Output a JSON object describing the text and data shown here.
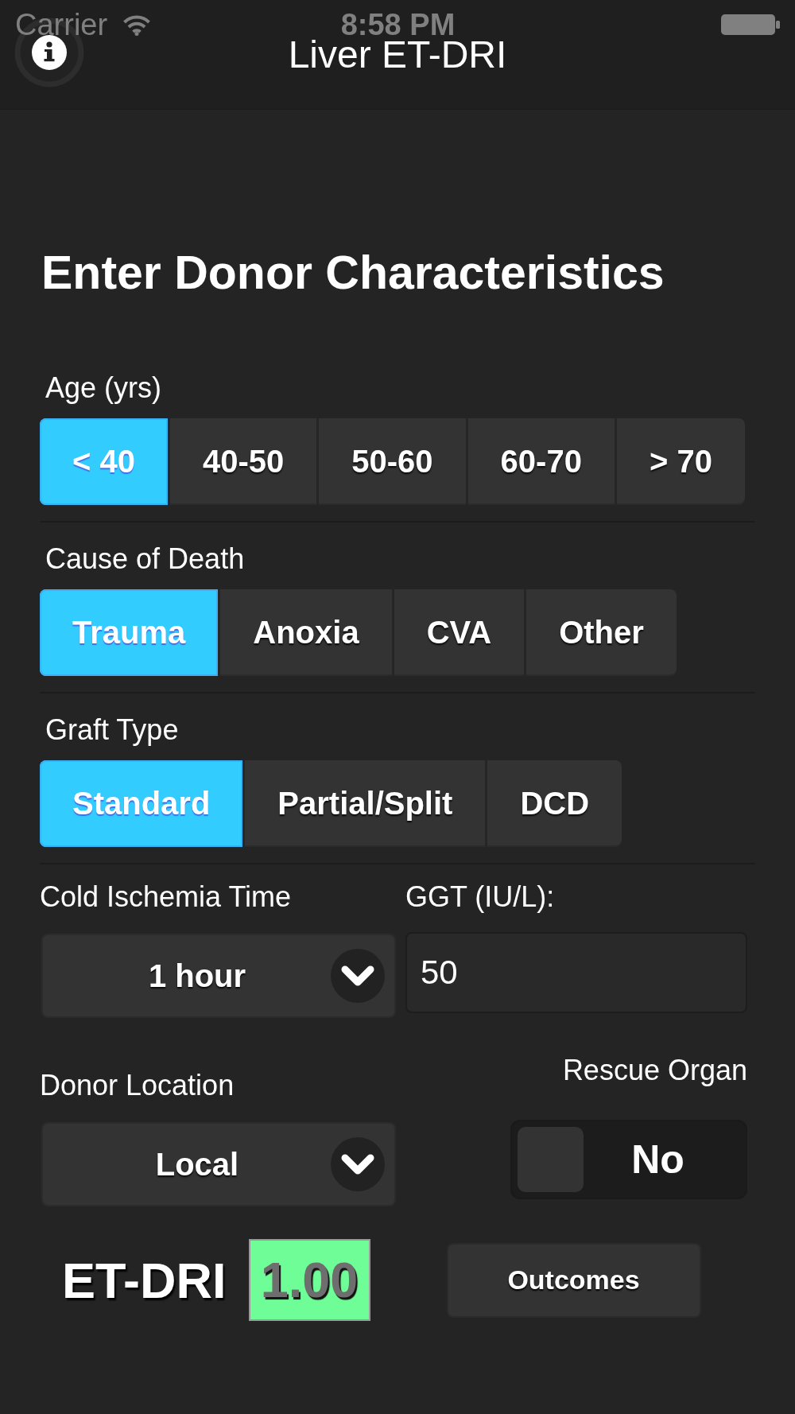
{
  "status_bar": {
    "carrier": "Carrier",
    "time": "8:58 PM"
  },
  "nav_bar": {
    "title": "Liver ET-DRI"
  },
  "heading": "Enter Donor Characteristics",
  "segments": [
    {
      "label": "Age (yrs)",
      "options": [
        {
          "label": "< 40",
          "selected": true
        },
        {
          "label": "40-50",
          "selected": false
        },
        {
          "label": "50-60",
          "selected": false
        },
        {
          "label": "60-70",
          "selected": false
        },
        {
          "label": "> 70",
          "selected": false
        }
      ]
    },
    {
      "label": "Cause of Death",
      "options": [
        {
          "label": "Trauma",
          "selected": true
        },
        {
          "label": "Anoxia",
          "selected": false
        },
        {
          "label": "CVA",
          "selected": false
        },
        {
          "label": "Other",
          "selected": false
        }
      ]
    },
    {
      "label": "Graft Type",
      "options": [
        {
          "label": "Standard",
          "selected": true
        },
        {
          "label": "Partial/Split",
          "selected": false
        },
        {
          "label": "DCD",
          "selected": false
        }
      ]
    }
  ],
  "cold_ischemia_time": {
    "label": "Cold Ischemia Time",
    "value": "1 hour"
  },
  "ggt": {
    "label": "GGT (IU/L):",
    "value": "50"
  },
  "donor_location": {
    "label": "Donor Location",
    "value": "Local"
  },
  "rescue_organ": {
    "label": "Rescue Organ",
    "on": false,
    "text": "No"
  },
  "result": {
    "label": "ET-DRI",
    "value": "1.00"
  },
  "outcomes_button": {
    "label": "Outcomes"
  }
}
